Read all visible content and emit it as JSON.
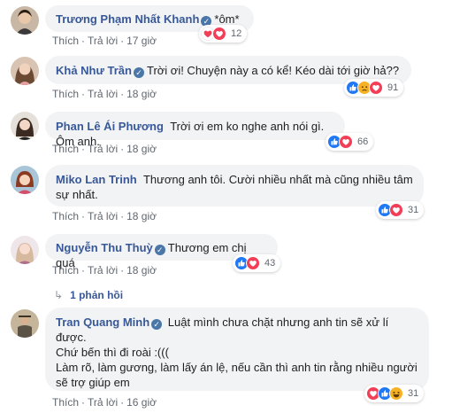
{
  "comments": [
    {
      "author": "Trương Phạm Nhất Khanh",
      "text": "*ôm*",
      "like_label": "Thích",
      "reply_label": "Trả lời",
      "time": "17 giờ",
      "reaction_count": "12",
      "reaction_types": [
        "heart-reaction",
        "love-reaction"
      ]
    },
    {
      "author": "Khả Như Trần",
      "text": "Trời ơi! Chuyện này a có kể! Kéo dài tới giờ hả??",
      "like_label": "Thích",
      "reply_label": "Trả lời",
      "time": "18 giờ",
      "reaction_count": "91",
      "reaction_types": [
        "like-reaction",
        "sad-reaction",
        "love-reaction"
      ]
    },
    {
      "author": "Phan Lê Ái Phương",
      "text": "Trời ơi em ko nghe anh nói gì. Ôm anh.",
      "like_label": "Thích",
      "reply_label": "Trả lời",
      "time": "18 giờ",
      "reaction_count": "66",
      "reaction_types": [
        "like-reaction",
        "love-reaction"
      ]
    },
    {
      "author": "Miko Lan Trinh",
      "text_line1": "Thương anh tôi. Cười nhiều nhất mà cũng nhiều tâm",
      "text_line2": "sự nhất.",
      "like_label": "Thích",
      "reply_label": "Trả lời",
      "time": "18 giờ",
      "reaction_count": "31",
      "reaction_types": [
        "like-reaction",
        "love-reaction"
      ]
    },
    {
      "author": "Nguyễn Thu Thuỳ",
      "text": "Thương em chị quá",
      "like_label": "Thích",
      "reply_label": "Trả lời",
      "time": "18 giờ",
      "reaction_count": "43",
      "reaction_types": [
        "like-reaction",
        "love-reaction"
      ],
      "replies_label": "1 phản hồi"
    },
    {
      "author": "Tran Quang Minh",
      "text_line1": "Luật mình chưa chặt nhưng anh tin sẽ xử lí",
      "text_line2": "được.",
      "text_line3": "Chứ bến thì đi roài :(((",
      "text_line4": "Làm rõ, làm gương, làm lấy án lệ, nếu cần thì anh tin rằng nhiều người",
      "text_line5": "sẽ trợ giúp em",
      "like_label": "Thích",
      "reply_label": "Trả lời",
      "time": "16 giờ",
      "reaction_count": "31",
      "reaction_types": [
        "love-reaction",
        "like-reaction",
        "haha-reaction"
      ]
    }
  ],
  "colors": {
    "author": "#385898",
    "bubble": "#f2f3f5",
    "meta": "#606770",
    "like_blue": "#2078f4",
    "love_red": "#f33e58",
    "emoji_yellow": "#f7b125"
  }
}
